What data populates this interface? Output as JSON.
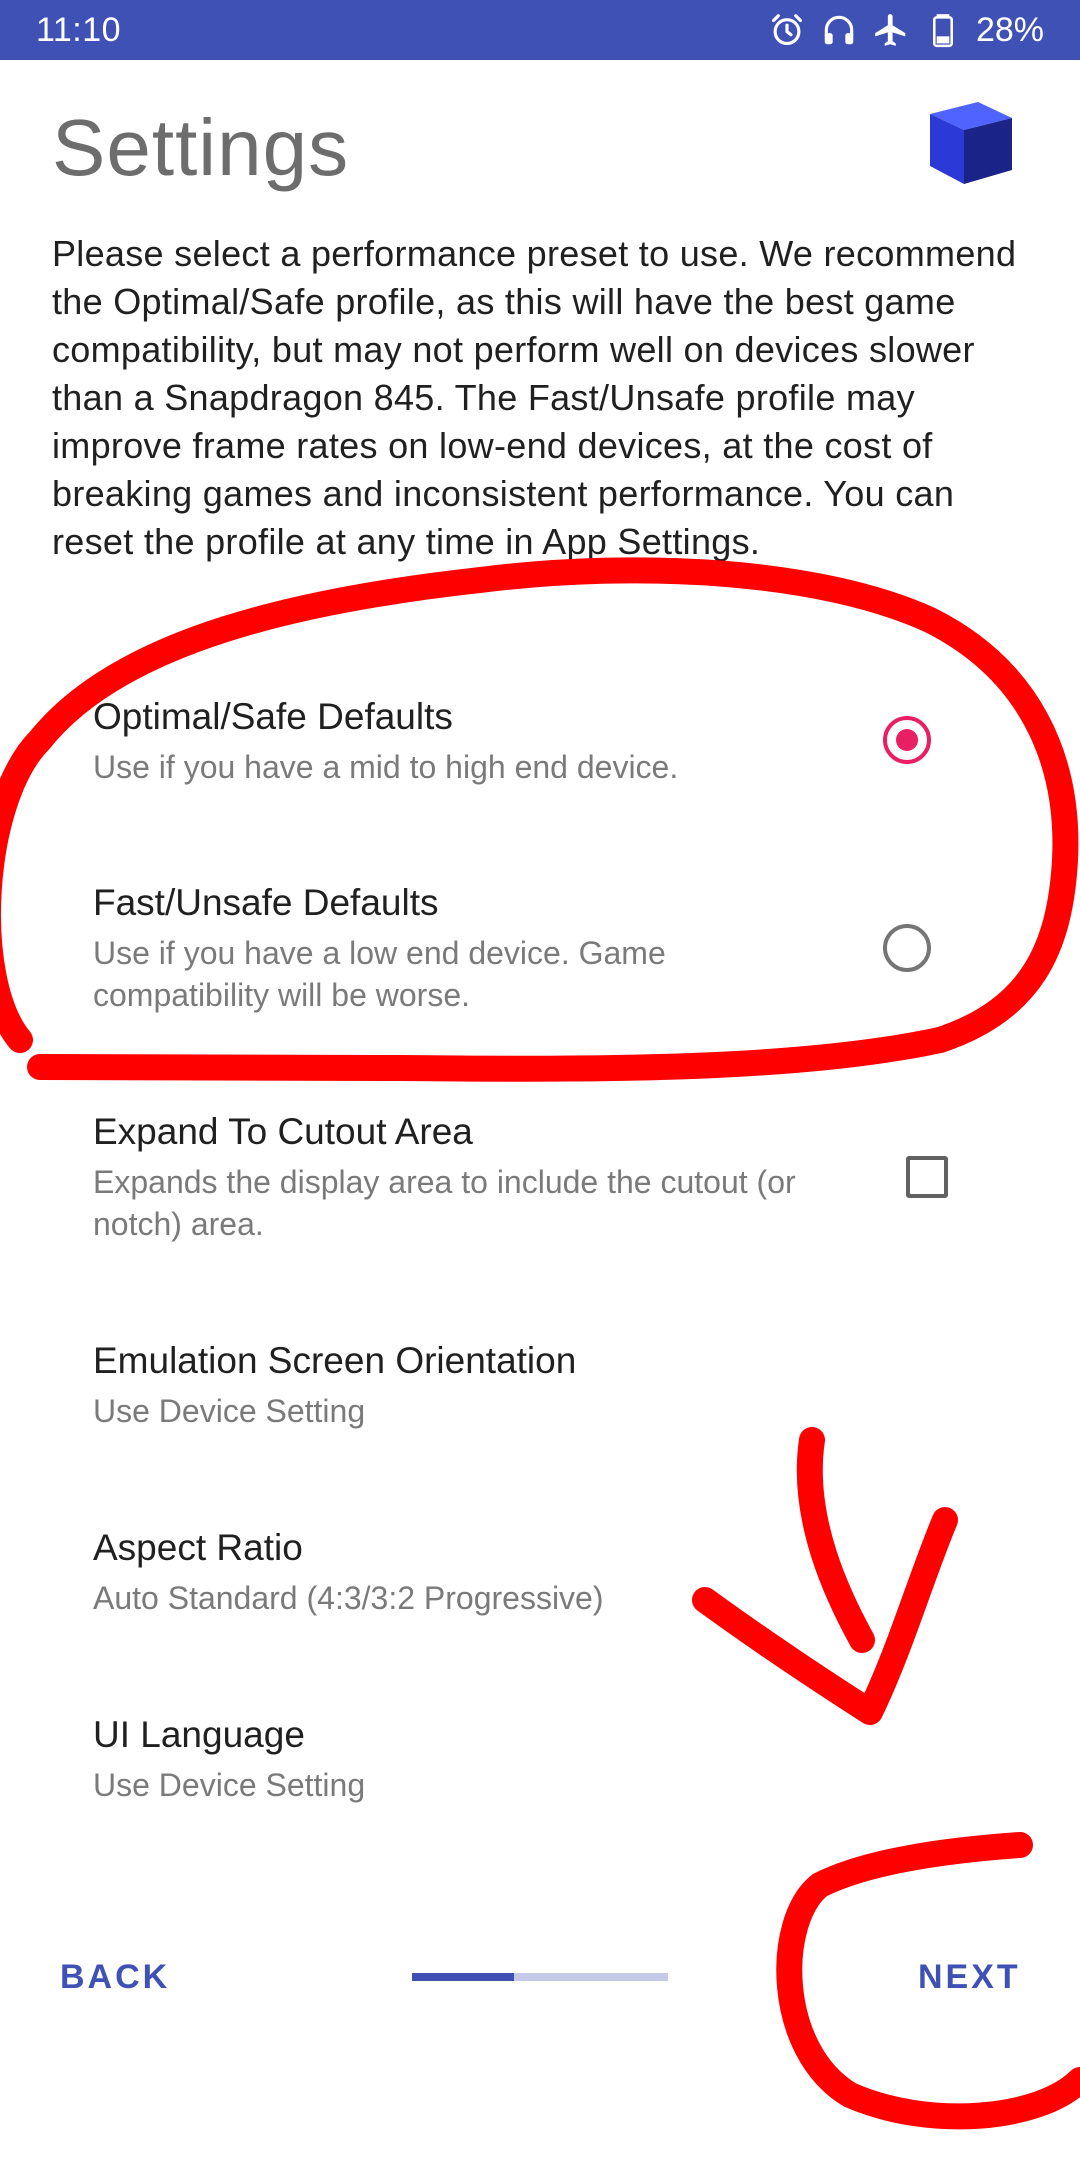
{
  "status_bar": {
    "time": "11:10",
    "battery": "28%",
    "icons": [
      "alarm-icon",
      "headset-icon",
      "airplane-icon",
      "battery-icon"
    ]
  },
  "header": {
    "title": "Settings",
    "logo": "cube-logo"
  },
  "description": "Please select a performance preset to use. We recommend the Optimal/Safe profile, as this will have the best game compatibility, but may not perform well on devices slower than a Snapdragon 845. The Fast/Unsafe profile may improve frame rates on low-end devices, at the cost of breaking games and inconsistent performance. You can reset the profile at any time in App Settings.",
  "settings": [
    {
      "title": "Optimal/Safe Defaults",
      "subtitle": "Use if you have a mid to high end device.",
      "control": "radio",
      "checked": true
    },
    {
      "title": "Fast/Unsafe Defaults",
      "subtitle": "Use if you have a low end device. Game compatibility will be worse.",
      "control": "radio",
      "checked": false
    },
    {
      "title": "Expand To Cutout Area",
      "subtitle": "Expands the display area to include the cutout (or notch) area.",
      "control": "checkbox",
      "checked": false
    },
    {
      "title": "Emulation Screen Orientation",
      "subtitle": "Use Device Setting",
      "control": "none"
    },
    {
      "title": "Aspect Ratio",
      "subtitle": "Auto Standard (4:3/3:2 Progressive)",
      "control": "none"
    },
    {
      "title": "UI Language",
      "subtitle": "Use Device Setting",
      "control": "none"
    }
  ],
  "nav": {
    "back_label": "BACK",
    "next_label": "NEXT",
    "progress_fraction": 0.4
  },
  "colors": {
    "accent": "#3f51b5",
    "radio_active": "#e91e63",
    "annotation": "#ff0000"
  }
}
